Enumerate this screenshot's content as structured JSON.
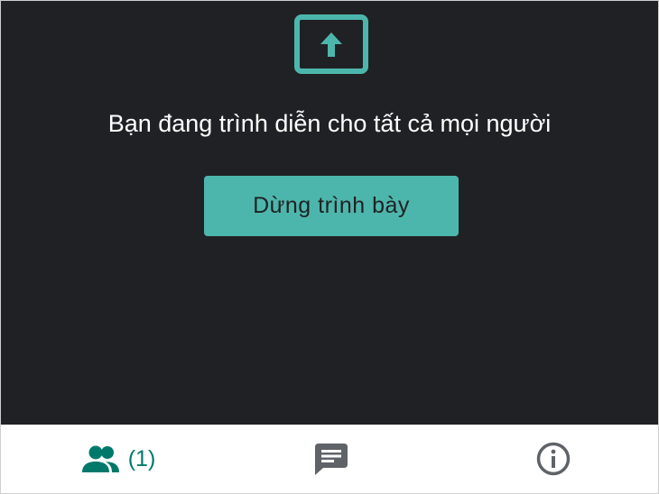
{
  "presenting": {
    "message": "Bạn đang trình diễn cho tất cả mọi người",
    "stop_button_label": "Dừng trình bày",
    "icon": "present-to-all-icon"
  },
  "bottom_bar": {
    "people": {
      "icon": "people-icon",
      "count_label": "(1)"
    },
    "chat": {
      "icon": "chat-icon"
    },
    "info": {
      "icon": "info-icon"
    }
  },
  "colors": {
    "panel_background": "#202124",
    "accent": "#4db6ac",
    "active_tab": "#00796b",
    "inactive_icon": "#5f6368"
  }
}
